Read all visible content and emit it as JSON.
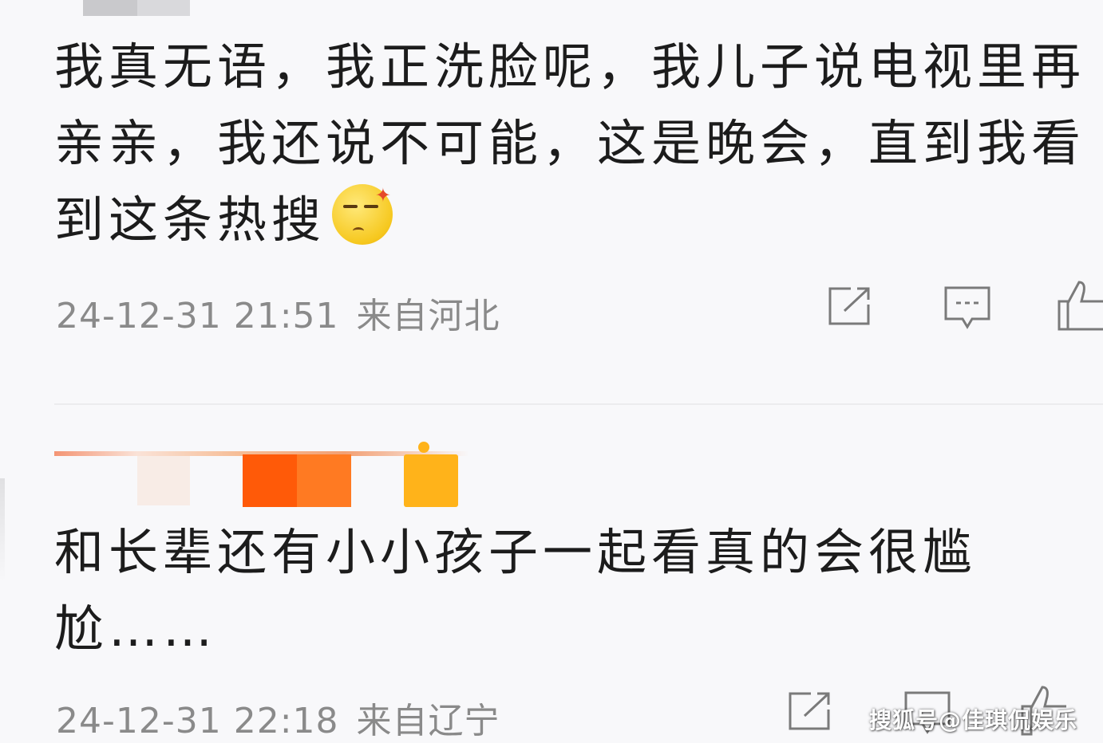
{
  "comments": [
    {
      "text": "我真无语，我正洗脸呢，我儿子说电视里再亲亲，我还说不可能，这是晚会，直到我看到这条热搜",
      "emoji_icon": "smirk-annoyed-emoji",
      "date": "24-12-31",
      "time": "21:51",
      "location": "来自河北"
    },
    {
      "text": "和长辈还有小小孩子一起看真的会很尴尬……",
      "date": "24-12-31",
      "time": "22:18",
      "location": "来自辽宁"
    }
  ],
  "actions": [
    "share-icon",
    "comment-icon",
    "like-icon"
  ],
  "watermark": "搜狐号@佳琪侃娱乐",
  "colors": {
    "text": "#1c1c1c",
    "meta": "#8a8a8a",
    "background": "#f8f8fa",
    "icon": "#7a7a7a"
  }
}
